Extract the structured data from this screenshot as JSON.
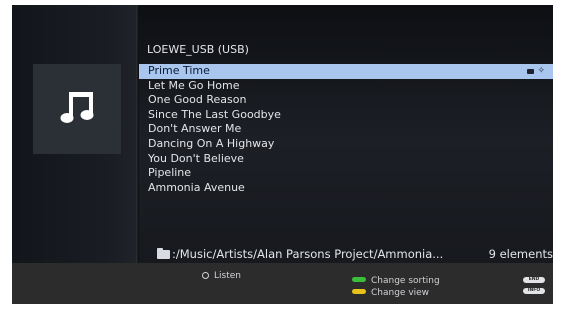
{
  "source": {
    "title": "LOEWE_USB (USB)"
  },
  "tracks": [
    {
      "title": "Prime Time",
      "selected": true
    },
    {
      "title": "Let Me Go Home",
      "selected": false
    },
    {
      "title": "One Good Reason",
      "selected": false
    },
    {
      "title": "Since The Last Goodbye",
      "selected": false
    },
    {
      "title": "Don't Answer Me",
      "selected": false
    },
    {
      "title": "Dancing On A Highway",
      "selected": false
    },
    {
      "title": "You Don't Believe",
      "selected": false
    },
    {
      "title": "Pipeline",
      "selected": false
    },
    {
      "title": "Ammonia Avenue",
      "selected": false
    }
  ],
  "path_bar": {
    "path": ":/Music/Artists/Alan Parsons Project/Ammonia...",
    "count": "9 elements"
  },
  "footer": {
    "listen": "Listen",
    "change_sorting": "Change sorting",
    "change_view": "Change view",
    "end_key": "END",
    "info_key": "INFO"
  },
  "icons": {
    "music_tile": "music-note-icon",
    "folder": "folder-icon",
    "ok_button": "ok-button-icon",
    "green_button": "green-key-icon",
    "yellow_button": "yellow-key-icon"
  },
  "colors": {
    "selection": "#a9c7ee",
    "green_key": "#3bbf3b",
    "yellow_key": "#e6c21a"
  }
}
